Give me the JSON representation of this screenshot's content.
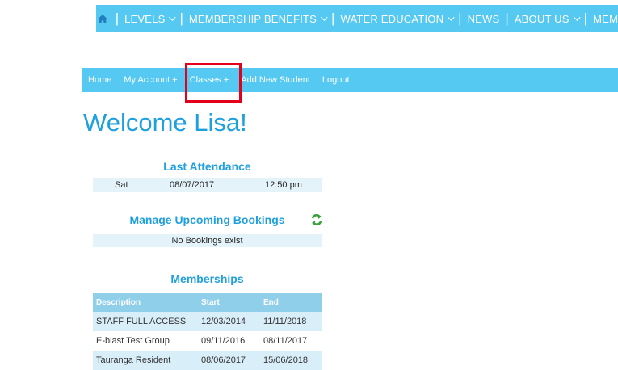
{
  "topnav": {
    "items": [
      {
        "label": "LEVELS",
        "dropdown": true
      },
      {
        "label": "MEMBERSHIP BENEFITS",
        "dropdown": true
      },
      {
        "label": "WATER EDUCATION",
        "dropdown": true
      },
      {
        "label": "NEWS",
        "dropdown": false
      },
      {
        "label": "ABOUT US",
        "dropdown": true
      },
      {
        "label": "MEM",
        "dropdown": false
      }
    ]
  },
  "membernav": {
    "home": "Home",
    "my_account": "My Account +",
    "classes": "Classes +",
    "add_student": "Add New Student",
    "logout": "Logout"
  },
  "welcome": "Welcome Lisa!",
  "last_attendance": {
    "title": "Last Attendance",
    "day": "Sat",
    "date": "08/07/2017",
    "time": "12:50 pm"
  },
  "bookings": {
    "title": "Manage Upcoming Bookings",
    "empty": "No Bookings exist"
  },
  "memberships": {
    "title": "Memberships",
    "headers": [
      "Description",
      "Start",
      "End"
    ],
    "rows": [
      [
        "STAFF FULL ACCESS",
        "12/03/2014",
        "11/11/2018"
      ],
      [
        "E-blast Test Group",
        "09/11/2016",
        "08/11/2017"
      ],
      [
        "Tauranga Resident",
        "08/06/2017",
        "15/06/2018"
      ]
    ]
  },
  "colors": {
    "nav_blue": "#55c9f1",
    "heading_blue": "#1fa0de",
    "highlight_red": "#e3001b"
  }
}
